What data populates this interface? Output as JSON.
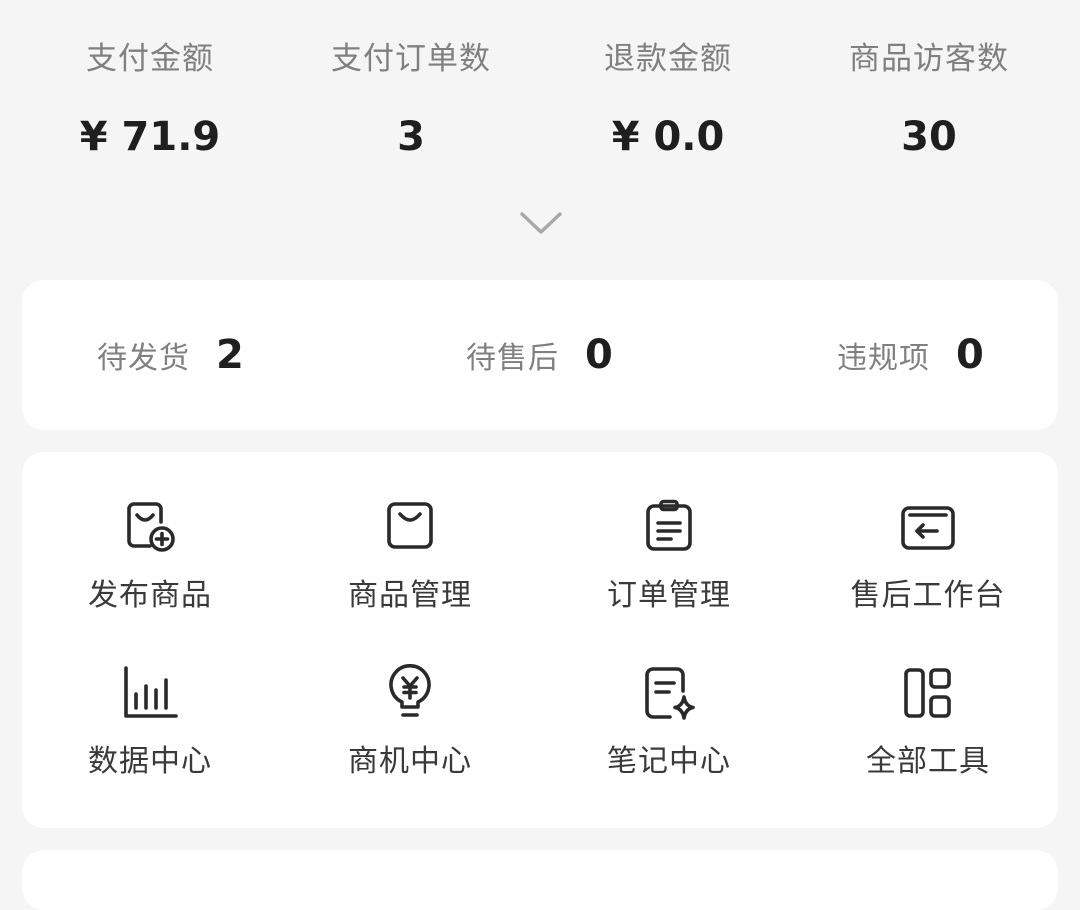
{
  "stats": [
    {
      "label": "支付金额",
      "value": "¥ 71.9"
    },
    {
      "label": "支付订单数",
      "value": "3"
    },
    {
      "label": "退款金额",
      "value": "¥ 0.0"
    },
    {
      "label": "商品访客数",
      "value": "30"
    }
  ],
  "todo": [
    {
      "label": "待发货",
      "value": "2"
    },
    {
      "label": "待售后",
      "value": "0"
    },
    {
      "label": "违规项",
      "value": "0"
    }
  ],
  "tools": [
    {
      "label": "发布商品",
      "icon": "bag-plus-icon"
    },
    {
      "label": "商品管理",
      "icon": "shopping-bag-icon"
    },
    {
      "label": "订单管理",
      "icon": "clipboard-icon"
    },
    {
      "label": "售后工作台",
      "icon": "return-box-icon"
    },
    {
      "label": "数据中心",
      "icon": "bar-chart-icon"
    },
    {
      "label": "商机中心",
      "icon": "yuan-bulb-icon"
    },
    {
      "label": "笔记中心",
      "icon": "note-sparkle-icon"
    },
    {
      "label": "全部工具",
      "icon": "grid-icon"
    }
  ],
  "colors": {
    "background": "#f5f5f5",
    "card": "#ffffff",
    "label": "#808080",
    "value": "#1f1f1f"
  }
}
